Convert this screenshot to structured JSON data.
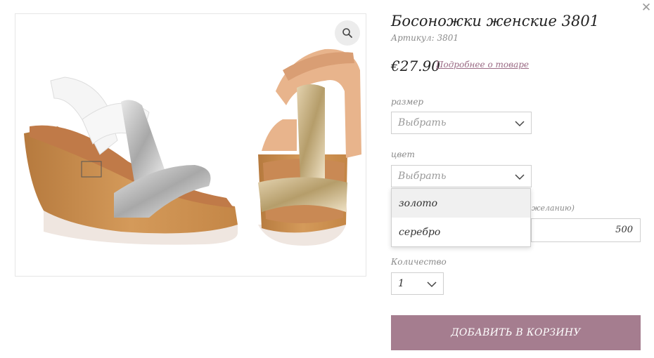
{
  "product": {
    "title": "Босоножки женские 3801",
    "sku_label": "Артикул:",
    "sku_value": "3801",
    "price": "€27.90",
    "details_link": "Подробнее о товаре"
  },
  "size": {
    "label": "размер",
    "value": "Выбрать"
  },
  "color": {
    "label": "цвет",
    "value": "Выбрать",
    "options": [
      "золото",
      "серебро"
    ],
    "hovered_option": "золото"
  },
  "custom_field": {
    "label_partial": "желанию)",
    "value": "500"
  },
  "quantity": {
    "label": "Количество",
    "value": "1"
  },
  "add_to_cart": "ДОБАВИТЬ В КОРЗИНУ",
  "icons": {
    "close": "close-icon",
    "zoom": "magnifier-icon",
    "chevron": "chevron-down-icon"
  },
  "colors": {
    "accent": "#a57d8f",
    "link": "#9b6b85",
    "border": "#cfcfcf"
  }
}
